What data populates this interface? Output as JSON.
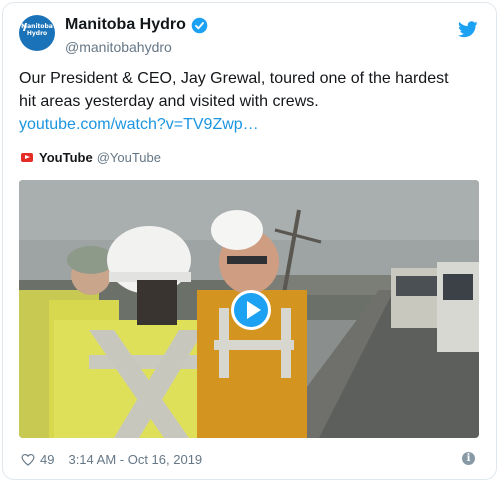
{
  "account": {
    "display_name": "Manitoba Hydro",
    "handle": "@manitobahydro",
    "avatar_text": "Manitoba Hydro",
    "verified": true
  },
  "tweet": {
    "text": "Our President & CEO, Jay Grewal, toured one of the hardest hit areas yesterday and visited with crews. ",
    "link_text": "youtube.com/watch?v=TV9Zwp…"
  },
  "source": {
    "icon": "youtube-icon",
    "name": "YouTube",
    "handle": "@YouTube"
  },
  "video": {
    "play_icon": "play-icon"
  },
  "footer": {
    "likes": "49",
    "timestamp": "3:14 AM - Oct 16, 2019",
    "info_icon": "i"
  },
  "colors": {
    "link": "#1b95e0",
    "twitter_blue": "#1da1f2",
    "avatar_bg": "#1a73b8",
    "muted": "#657786"
  }
}
